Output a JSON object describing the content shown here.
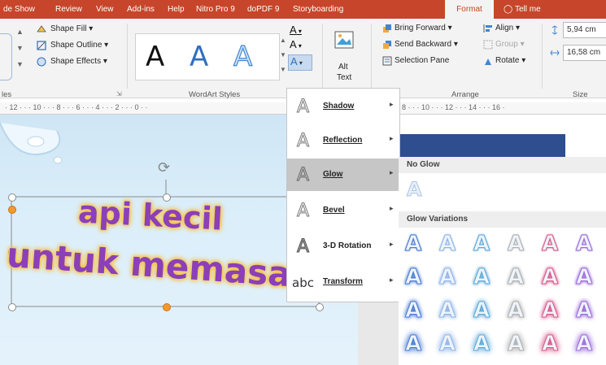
{
  "tabs": [
    {
      "label": "de Show"
    },
    {
      "label": "Review"
    },
    {
      "label": "View"
    },
    {
      "label": "Add-ins"
    },
    {
      "label": "Help"
    },
    {
      "label": "Nitro Pro 9"
    },
    {
      "label": "doPDF 9"
    },
    {
      "label": "Storyboarding"
    },
    {
      "label": "Format"
    }
  ],
  "tell_me": "Tell me",
  "shape_styles": {
    "shape_fill": "Shape Fill",
    "shape_outline": "Shape Outline",
    "shape_effects": "Shape Effects",
    "group_label": "les"
  },
  "wordart": {
    "group_label": "WordArt Styles",
    "sample": "A"
  },
  "alt_text": {
    "label_line1": "Alt",
    "label_line2": "Text"
  },
  "arrange": {
    "bring_forward": "Bring Forward",
    "send_backward": "Send Backward",
    "selection_pane": "Selection Pane",
    "align": "Align",
    "group": "Group",
    "rotate": "Rotate",
    "group_label": "Arrange"
  },
  "size": {
    "height": "5,94 cm",
    "width": "16,58 cm",
    "group_label": "Size"
  },
  "ruler": {
    "left": "· 12 · · · 10 · · · 8 · · · 6 · · · 4 · · · 2 · · · 0 · ·",
    "right": "8 · · · 10 · · · 12 · · · 14 · · · 16 ·"
  },
  "slide": {
    "line1": "api kecil",
    "line2": "untuk memasa"
  },
  "menu": [
    {
      "label": "Shadow",
      "icon": "A"
    },
    {
      "label": "Reflection",
      "icon": "A"
    },
    {
      "label": "Glow",
      "icon": "A"
    },
    {
      "label": "Bevel",
      "icon": "A"
    },
    {
      "label": "3-D Rotation",
      "icon": "A"
    },
    {
      "label": "Transform",
      "icon": "abc"
    }
  ],
  "glow_panel": {
    "no_glow": "No Glow",
    "variations": "Glow Variations",
    "sample": "A",
    "colors": [
      "#4a7bd1",
      "#8fb4e8",
      "#5fa9d6",
      "#b0b0b0",
      "#d85a8a",
      "#9b6ad8"
    ]
  },
  "colors": {
    "accent": "#c7452a",
    "wordart_fill": "#8b3fb8",
    "wordart_glow": "#f6c24a"
  }
}
